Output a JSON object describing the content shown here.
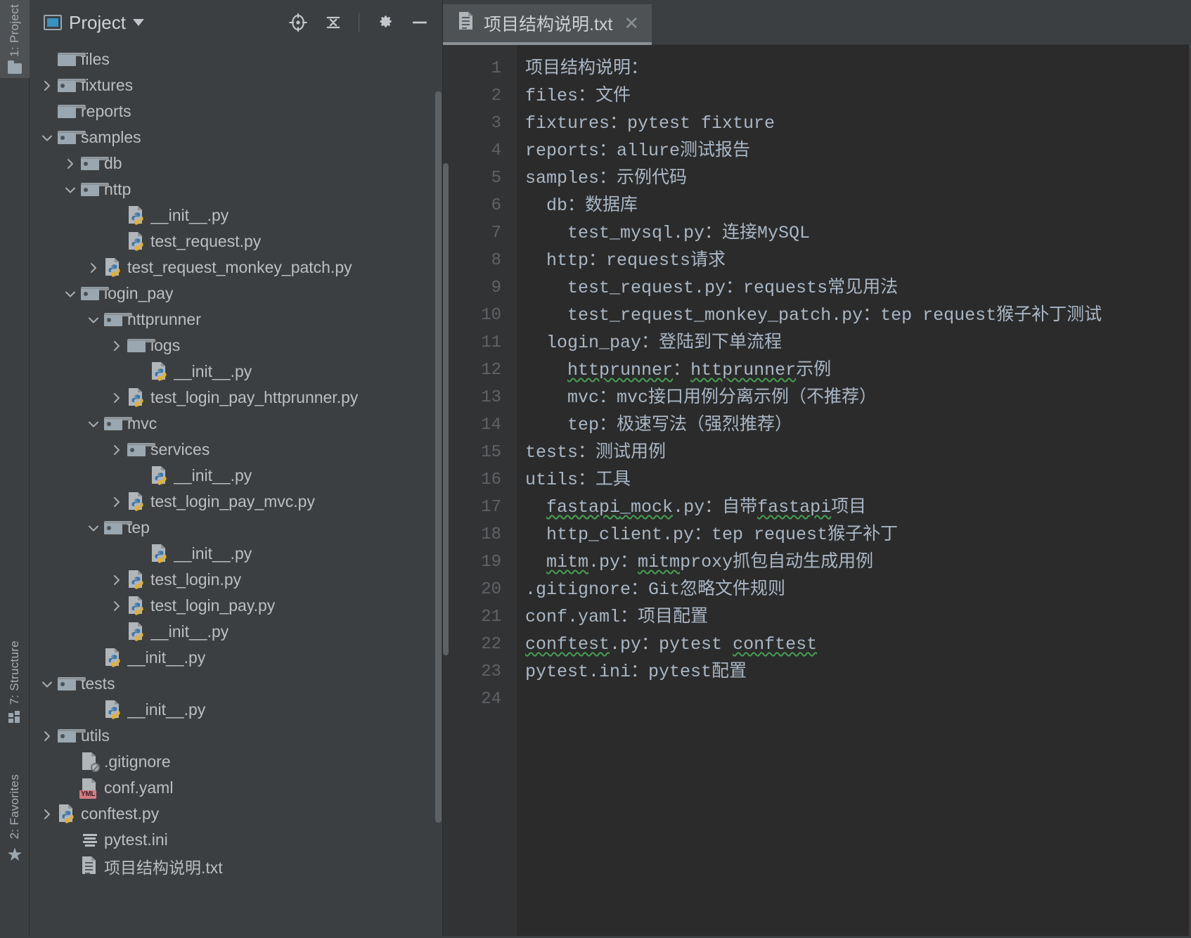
{
  "toolwindows": {
    "project": {
      "label": "1: Project",
      "icon": "project-folder-icon",
      "active": true
    },
    "structure": {
      "label": "7: Structure",
      "icon": "structure-icon",
      "active": false
    },
    "favorites": {
      "label": "2: Favorites",
      "icon": "star-icon",
      "active": false
    }
  },
  "project_panel": {
    "title": "Project",
    "title_icon": "project-window-icon",
    "dropdown_icon": "chevron-down-icon",
    "actions": [
      {
        "name": "locate-icon",
        "tooltip": "Select Opened File"
      },
      {
        "name": "collapse-all-icon",
        "tooltip": "Collapse All"
      },
      {
        "name": "settings-gear-icon",
        "tooltip": "Settings"
      },
      {
        "name": "hide-icon",
        "tooltip": "Hide"
      }
    ],
    "tree": [
      {
        "label": "files",
        "indent": 1,
        "arrow": "none",
        "icon": "folder"
      },
      {
        "label": "fixtures",
        "indent": 1,
        "arrow": "collapsed",
        "icon": "package-folder"
      },
      {
        "label": "reports",
        "indent": 1,
        "arrow": "none",
        "icon": "folder"
      },
      {
        "label": "samples",
        "indent": 1,
        "arrow": "expanded",
        "icon": "package-folder"
      },
      {
        "label": "db",
        "indent": 2,
        "arrow": "collapsed",
        "icon": "package-folder"
      },
      {
        "label": "http",
        "indent": 2,
        "arrow": "expanded",
        "icon": "package-folder"
      },
      {
        "label": "__init__.py",
        "indent": 4,
        "arrow": "none",
        "icon": "python-file"
      },
      {
        "label": "test_request.py",
        "indent": 4,
        "arrow": "none",
        "icon": "python-file"
      },
      {
        "label": "test_request_monkey_patch.py",
        "indent": 3,
        "arrow": "collapsed",
        "icon": "python-file"
      },
      {
        "label": "login_pay",
        "indent": 2,
        "arrow": "expanded",
        "icon": "package-folder"
      },
      {
        "label": "httprunner",
        "indent": 3,
        "arrow": "expanded",
        "icon": "package-folder"
      },
      {
        "label": "logs",
        "indent": 4,
        "arrow": "collapsed",
        "icon": "folder"
      },
      {
        "label": "__init__.py",
        "indent": 5,
        "arrow": "none",
        "icon": "python-file"
      },
      {
        "label": "test_login_pay_httprunner.py",
        "indent": 4,
        "arrow": "collapsed",
        "icon": "python-file"
      },
      {
        "label": "mvc",
        "indent": 3,
        "arrow": "expanded",
        "icon": "package-folder"
      },
      {
        "label": "services",
        "indent": 4,
        "arrow": "collapsed",
        "icon": "package-folder"
      },
      {
        "label": "__init__.py",
        "indent": 5,
        "arrow": "none",
        "icon": "python-file"
      },
      {
        "label": "test_login_pay_mvc.py",
        "indent": 4,
        "arrow": "collapsed",
        "icon": "python-file"
      },
      {
        "label": "tep",
        "indent": 3,
        "arrow": "expanded",
        "icon": "package-folder"
      },
      {
        "label": "__init__.py",
        "indent": 5,
        "arrow": "none",
        "icon": "python-file"
      },
      {
        "label": "test_login.py",
        "indent": 4,
        "arrow": "collapsed",
        "icon": "python-file"
      },
      {
        "label": "test_login_pay.py",
        "indent": 4,
        "arrow": "collapsed",
        "icon": "python-file"
      },
      {
        "label": "__init__.py",
        "indent": 4,
        "arrow": "none",
        "icon": "python-file"
      },
      {
        "label": "__init__.py",
        "indent": 3,
        "arrow": "none",
        "icon": "python-file"
      },
      {
        "label": "tests",
        "indent": 1,
        "arrow": "expanded",
        "icon": "package-folder"
      },
      {
        "label": "__init__.py",
        "indent": 3,
        "arrow": "none",
        "icon": "python-file"
      },
      {
        "label": "utils",
        "indent": 1,
        "arrow": "collapsed",
        "icon": "package-folder"
      },
      {
        "label": ".gitignore",
        "indent": 2,
        "arrow": "none",
        "icon": "gitignore-file"
      },
      {
        "label": "conf.yaml",
        "indent": 2,
        "arrow": "none",
        "icon": "yaml-file"
      },
      {
        "label": "conftest.py",
        "indent": 1,
        "arrow": "collapsed",
        "icon": "python-file"
      },
      {
        "label": "pytest.ini",
        "indent": 2,
        "arrow": "none",
        "icon": "ini-file"
      },
      {
        "label": "项目结构说明.txt",
        "indent": 2,
        "arrow": "none",
        "icon": "text-file"
      }
    ]
  },
  "editor": {
    "tab": {
      "label": "项目结构说明.txt",
      "icon": "text-file-icon",
      "close_icon": "close-icon",
      "active": true
    },
    "total_lines": 24,
    "lines": [
      {
        "n": 1,
        "text": "项目结构说明："
      },
      {
        "n": 2,
        "text": "files：文件"
      },
      {
        "n": 3,
        "text": "fixtures：pytest fixture"
      },
      {
        "n": 4,
        "text": "reports：allure测试报告"
      },
      {
        "n": 5,
        "text": "samples：示例代码"
      },
      {
        "n": 6,
        "text": "  db：数据库"
      },
      {
        "n": 7,
        "text": "    test_mysql.py：连接MySQL"
      },
      {
        "n": 8,
        "text": "  http：requests请求"
      },
      {
        "n": 9,
        "text": "    test_request.py：requests常见用法"
      },
      {
        "n": 10,
        "text": "    test_request_monkey_patch.py：tep request猴子补丁测试"
      },
      {
        "n": 11,
        "text": "  login_pay：登陆到下单流程"
      },
      {
        "n": 12,
        "text": "    httprunner：httprunner示例",
        "spell": [
          "httprunner",
          "httprunner"
        ]
      },
      {
        "n": 13,
        "text": "    mvc：mvc接口用例分离示例（不推荐）"
      },
      {
        "n": 14,
        "text": "    tep：极速写法（强烈推荐）"
      },
      {
        "n": 15,
        "text": "tests：测试用例"
      },
      {
        "n": 16,
        "text": "utils：工具"
      },
      {
        "n": 17,
        "text": "  fastapi_mock.py：自带fastapi项目",
        "spell": [
          "fastapi_mock",
          "fastapi"
        ]
      },
      {
        "n": 18,
        "text": "  http_client.py：tep request猴子补丁"
      },
      {
        "n": 19,
        "text": "  mitm.py：mitmproxy抓包自动生成用例",
        "spell": [
          "mitm"
        ]
      },
      {
        "n": 20,
        "text": ".gitignore：Git忽略文件规则"
      },
      {
        "n": 21,
        "text": "conf.yaml：项目配置"
      },
      {
        "n": 22,
        "text": "conftest.py：pytest conftest",
        "spell": [
          "conftest",
          "conftest"
        ]
      },
      {
        "n": 23,
        "text": "pytest.ini：pytest配置"
      },
      {
        "n": 24,
        "text": ""
      }
    ]
  },
  "colors": {
    "panel_bg": "#3c3f41",
    "editor_bg": "#2b2b2b",
    "gutter_bg": "#313335",
    "text": "#a9b7c6",
    "tree_text": "#bcbec0",
    "accent_blue": "#3592c4",
    "spell_underline": "#499c54",
    "yml_badge": "#d67b84",
    "tab_active": "#4e5254"
  }
}
